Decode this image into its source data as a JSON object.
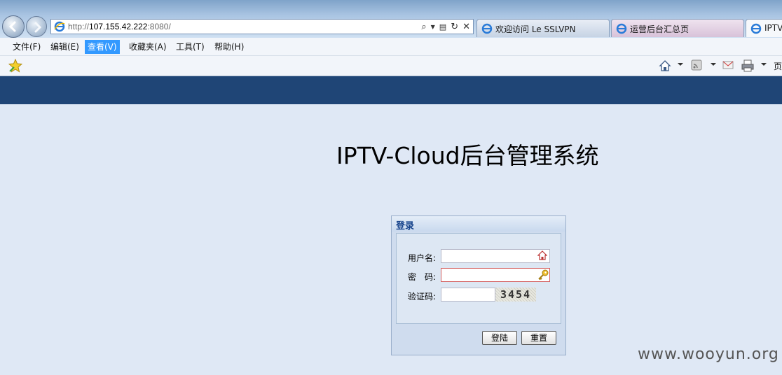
{
  "browser": {
    "address": {
      "prefix": "http://",
      "host": "107.155.42.222",
      "suffix": ":8080/"
    },
    "tabs": [
      {
        "label": "欢迎访问 Le SSLVPN"
      },
      {
        "label": "运营后台汇总页"
      },
      {
        "label": "IPTV"
      }
    ],
    "menu": [
      {
        "label": "文件(F)"
      },
      {
        "label": "编辑(E)"
      },
      {
        "label": "查看(V)",
        "active": true
      },
      {
        "label": "收藏夹(A)"
      },
      {
        "label": "工具(T)"
      },
      {
        "label": "帮助(H)"
      }
    ],
    "command_bar": {
      "page_label": "页",
      "icons": [
        "home-icon",
        "rss-icon",
        "mail-icon",
        "print-icon"
      ]
    }
  },
  "page": {
    "title": "IPTV-Cloud后台管理系统",
    "header_color": "#1f4576",
    "login": {
      "panel_title": "登录",
      "username_label": "用户名:",
      "password_label": "密　码:",
      "captcha_label": "验证码:",
      "username_value": "",
      "password_value": "",
      "captcha_value": "",
      "captcha_text": "3454",
      "login_button": "登陆",
      "reset_button": "重置"
    }
  },
  "watermark": "www.wooyun.org"
}
